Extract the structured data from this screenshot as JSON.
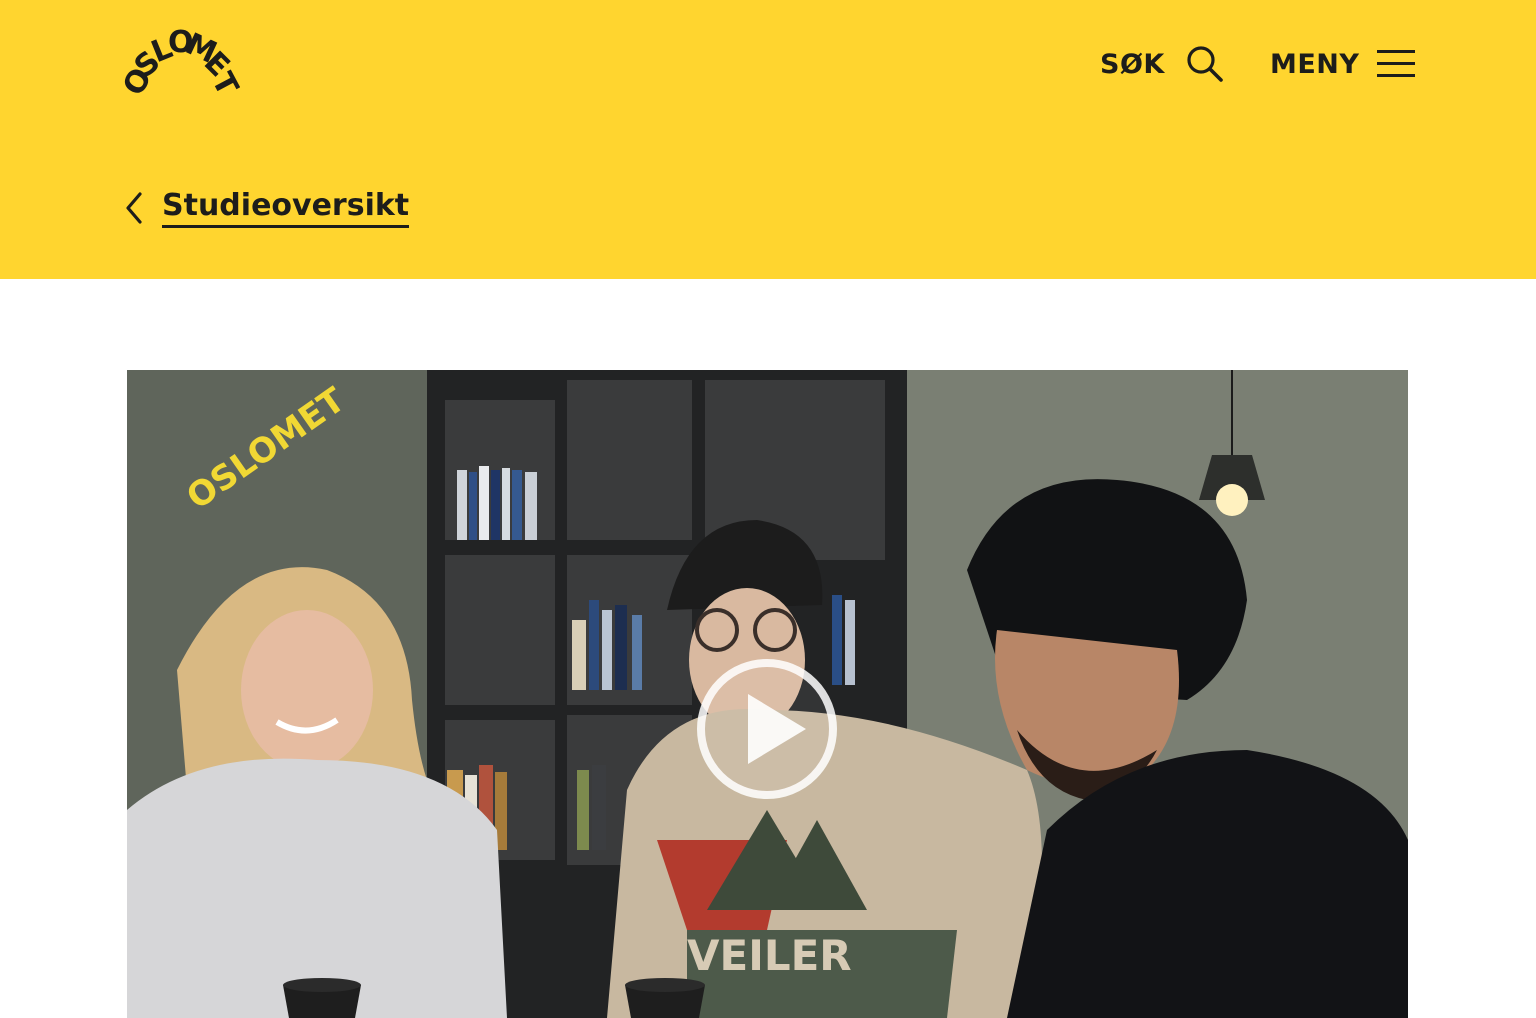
{
  "header": {
    "logo_text": "OSLOMET",
    "search_label": "SØK",
    "menu_label": "MENY",
    "background_color": "#ffd52f",
    "icons": {
      "search": "search-icon",
      "menu": "hamburger-menu-icon",
      "back": "chevron-left-icon"
    }
  },
  "breadcrumb": {
    "back_label": "Studieoversikt"
  },
  "video": {
    "watermark_text": "OSLOMET",
    "sweater_text": "VEILER",
    "play_icon": "play-icon"
  }
}
